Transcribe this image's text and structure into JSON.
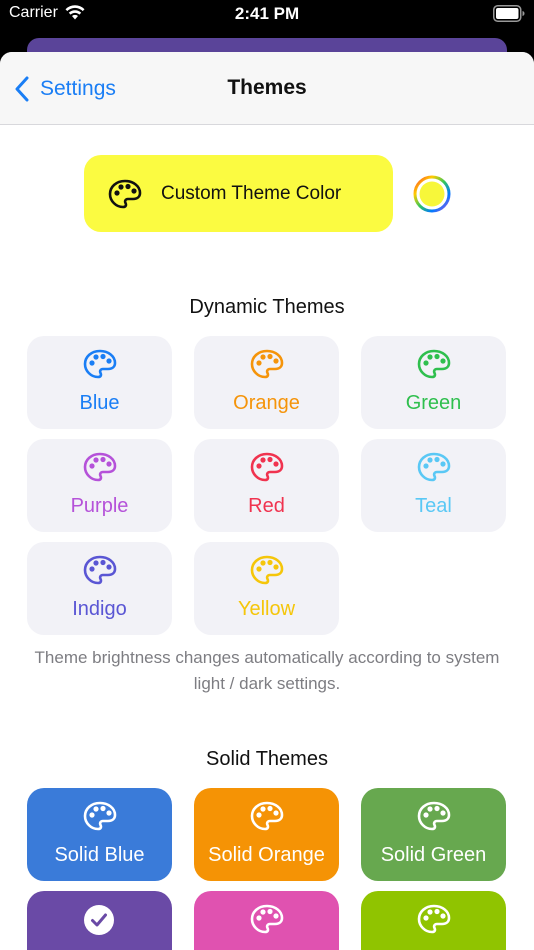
{
  "status_bar": {
    "carrier": "Carrier",
    "time": "2:41 PM"
  },
  "nav": {
    "back_label": "Settings",
    "title": "Themes"
  },
  "custom_theme": {
    "label": "Custom Theme Color",
    "background": "#fbfb41",
    "well_color": "#f7f73a"
  },
  "dynamic_section": {
    "heading": "Dynamic Themes",
    "themes": [
      {
        "label": "Blue",
        "color": "#1a7ef5"
      },
      {
        "label": "Orange",
        "color": "#f5940a"
      },
      {
        "label": "Green",
        "color": "#2fbf4e"
      },
      {
        "label": "Purple",
        "color": "#b552d9"
      },
      {
        "label": "Red",
        "color": "#f0334f"
      },
      {
        "label": "Teal",
        "color": "#5ac8f5"
      },
      {
        "label": "Indigo",
        "color": "#5a56d4"
      },
      {
        "label": "Yellow",
        "color": "#f5c60a"
      }
    ],
    "note": "Theme brightness changes automatically according to system light / dark settings."
  },
  "solid_section": {
    "heading": "Solid Themes",
    "themes": [
      {
        "label": "Solid Blue",
        "color": "#3a7bd9",
        "selected": false
      },
      {
        "label": "Solid Orange",
        "color": "#f59305",
        "selected": false
      },
      {
        "label": "Solid Green",
        "color": "#67a84f",
        "selected": false
      },
      {
        "label": "",
        "color": "#6a4aa6",
        "selected": true
      },
      {
        "label": "",
        "color": "#e052b0",
        "selected": false
      },
      {
        "label": "",
        "color": "#90c400",
        "selected": false
      }
    ]
  },
  "icons": {
    "back": "chevron-left-icon",
    "palette": "palette-icon",
    "check": "checkmark-circle-icon",
    "wifi": "wifi-icon",
    "battery": "battery-icon",
    "color_well": "color-well-icon"
  }
}
